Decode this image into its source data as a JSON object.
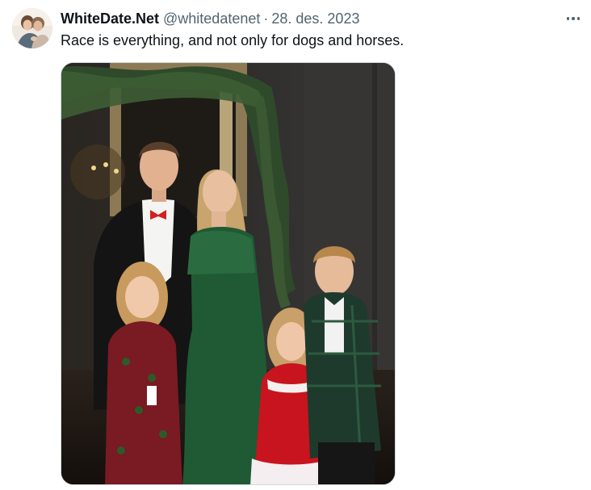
{
  "tweet": {
    "display_name": "WhiteDate.Net",
    "handle": "@whitedatenet",
    "separator": "·",
    "timestamp": "28. des. 2023",
    "text": "Race is everything, and not only for dogs and horses."
  },
  "media": {
    "alt": "Family portrait"
  },
  "icons": {
    "more": "more-horizontal-icon"
  },
  "colors": {
    "text_primary": "#0f1419",
    "text_secondary": "#536471",
    "border": "#cfd9de"
  }
}
